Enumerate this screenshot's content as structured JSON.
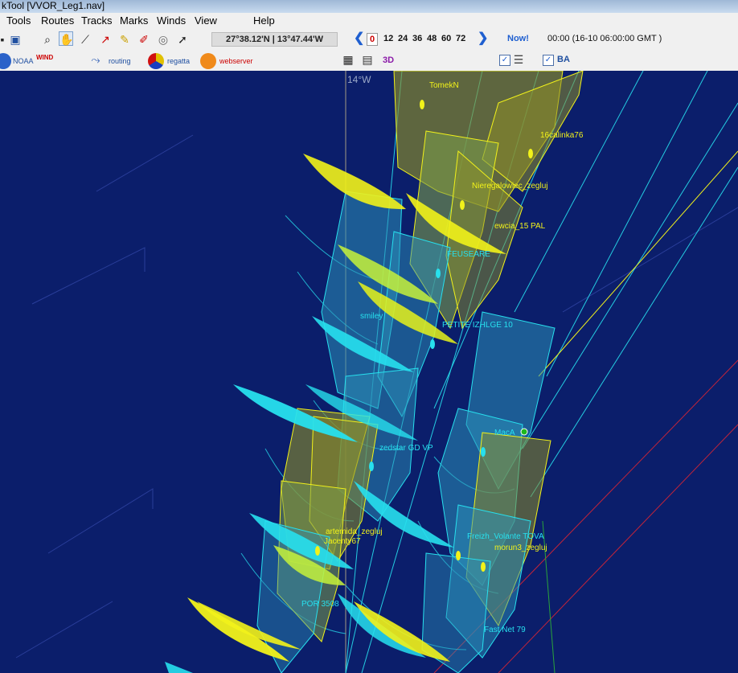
{
  "window": {
    "title": "kTool [VVOR_Leg1.nav]"
  },
  "menu": [
    "Tools",
    "Routes",
    "Tracks",
    "Marks",
    "Winds",
    "View",
    "Help"
  ],
  "toolbar": {
    "coords": "27°38.12'N | 13°47.44'W",
    "time_steps": [
      "0",
      "12",
      "24",
      "36",
      "48",
      "60",
      "72"
    ],
    "now_label": "Now!",
    "datetime": "00:00 (16-10 06:00:00 GMT )"
  },
  "toolbar2": {
    "noaa": "NOAA",
    "wind": "WIND",
    "routing": "routing",
    "regatta": "regatta",
    "webserver": "webserver",
    "three_d": "3D",
    "ba": "BA"
  },
  "map": {
    "longitude_label": "14°W",
    "boats": [
      {
        "name": "TomekN",
        "color": "yellow"
      },
      {
        "name": "16calinka76",
        "color": "yellow"
      },
      {
        "name": "Nieregalowiec_zegluj",
        "color": "yellow"
      },
      {
        "name": "ewcia_15 PAL",
        "color": "yellow"
      },
      {
        "name": "FEUSEARE",
        "color": "cyan"
      },
      {
        "name": "smiley",
        "color": "cyan"
      },
      {
        "name": "PETITE IZHLGE 10",
        "color": "cyan"
      },
      {
        "name": "zedstar GD VP",
        "color": "cyan"
      },
      {
        "name": "MacA",
        "color": "cyan"
      },
      {
        "name": "artemida_zegluj",
        "color": "yellow"
      },
      {
        "name": "Jacenty67",
        "color": "yellow"
      },
      {
        "name": "Freizh_Volante TOVA",
        "color": "cyan"
      },
      {
        "name": "morun3_zegluj",
        "color": "yellow"
      },
      {
        "name": "POR 3508",
        "color": "cyan"
      },
      {
        "name": "Fast Net 79",
        "color": "cyan"
      }
    ]
  },
  "colors": {
    "sea": "#0b1e6b",
    "yellow": "#f2f21a",
    "cyan": "#27e0ee",
    "route_red": "#c3243a"
  }
}
